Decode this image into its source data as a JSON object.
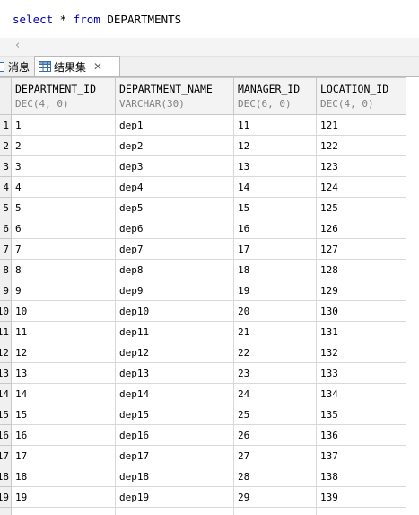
{
  "sql": {
    "kw_select": "select",
    "star": " * ",
    "kw_from": "from",
    "table": " DEPARTMENTS"
  },
  "tabs": {
    "messages": "消息",
    "results": "结果集"
  },
  "columns": [
    {
      "name": "DEPARTMENT_ID",
      "type": "DEC(4, 0)"
    },
    {
      "name": "DEPARTMENT_NAME",
      "type": "VARCHAR(30)"
    },
    {
      "name": "MANAGER_ID",
      "type": "DEC(6, 0)"
    },
    {
      "name": "LOCATION_ID",
      "type": "DEC(4, 0)"
    }
  ],
  "rows": [
    {
      "num": "1",
      "cells": [
        "1",
        "dep1",
        "11",
        "121"
      ]
    },
    {
      "num": "2",
      "cells": [
        "2",
        "dep2",
        "12",
        "122"
      ]
    },
    {
      "num": "3",
      "cells": [
        "3",
        "dep3",
        "13",
        "123"
      ]
    },
    {
      "num": "4",
      "cells": [
        "4",
        "dep4",
        "14",
        "124"
      ]
    },
    {
      "num": "5",
      "cells": [
        "5",
        "dep5",
        "15",
        "125"
      ]
    },
    {
      "num": "6",
      "cells": [
        "6",
        "dep6",
        "16",
        "126"
      ]
    },
    {
      "num": "7",
      "cells": [
        "7",
        "dep7",
        "17",
        "127"
      ]
    },
    {
      "num": "8",
      "cells": [
        "8",
        "dep8",
        "18",
        "128"
      ]
    },
    {
      "num": "9",
      "cells": [
        "9",
        "dep9",
        "19",
        "129"
      ]
    },
    {
      "num": "10",
      "cells": [
        "10",
        "dep10",
        "20",
        "130"
      ]
    },
    {
      "num": "11",
      "cells": [
        "11",
        "dep11",
        "21",
        "131"
      ]
    },
    {
      "num": "12",
      "cells": [
        "12",
        "dep12",
        "22",
        "132"
      ]
    },
    {
      "num": "13",
      "cells": [
        "13",
        "dep13",
        "23",
        "133"
      ]
    },
    {
      "num": "14",
      "cells": [
        "14",
        "dep14",
        "24",
        "134"
      ]
    },
    {
      "num": "15",
      "cells": [
        "15",
        "dep15",
        "25",
        "135"
      ]
    },
    {
      "num": "16",
      "cells": [
        "16",
        "dep16",
        "26",
        "136"
      ]
    },
    {
      "num": "17",
      "cells": [
        "17",
        "dep17",
        "27",
        "137"
      ]
    },
    {
      "num": "18",
      "cells": [
        "18",
        "dep18",
        "28",
        "138"
      ]
    },
    {
      "num": "19",
      "cells": [
        "19",
        "dep19",
        "29",
        "139"
      ]
    }
  ],
  "icons": {
    "messages": "messages-icon",
    "results": "grid-icon",
    "close": "close-icon",
    "scroll_left": "chevron-left-icon"
  },
  "colors": {
    "keyword": "#0000b0",
    "type_text": "#808080",
    "grid_line": "#d9d9d9",
    "header_bg": "#f3f3f3"
  }
}
